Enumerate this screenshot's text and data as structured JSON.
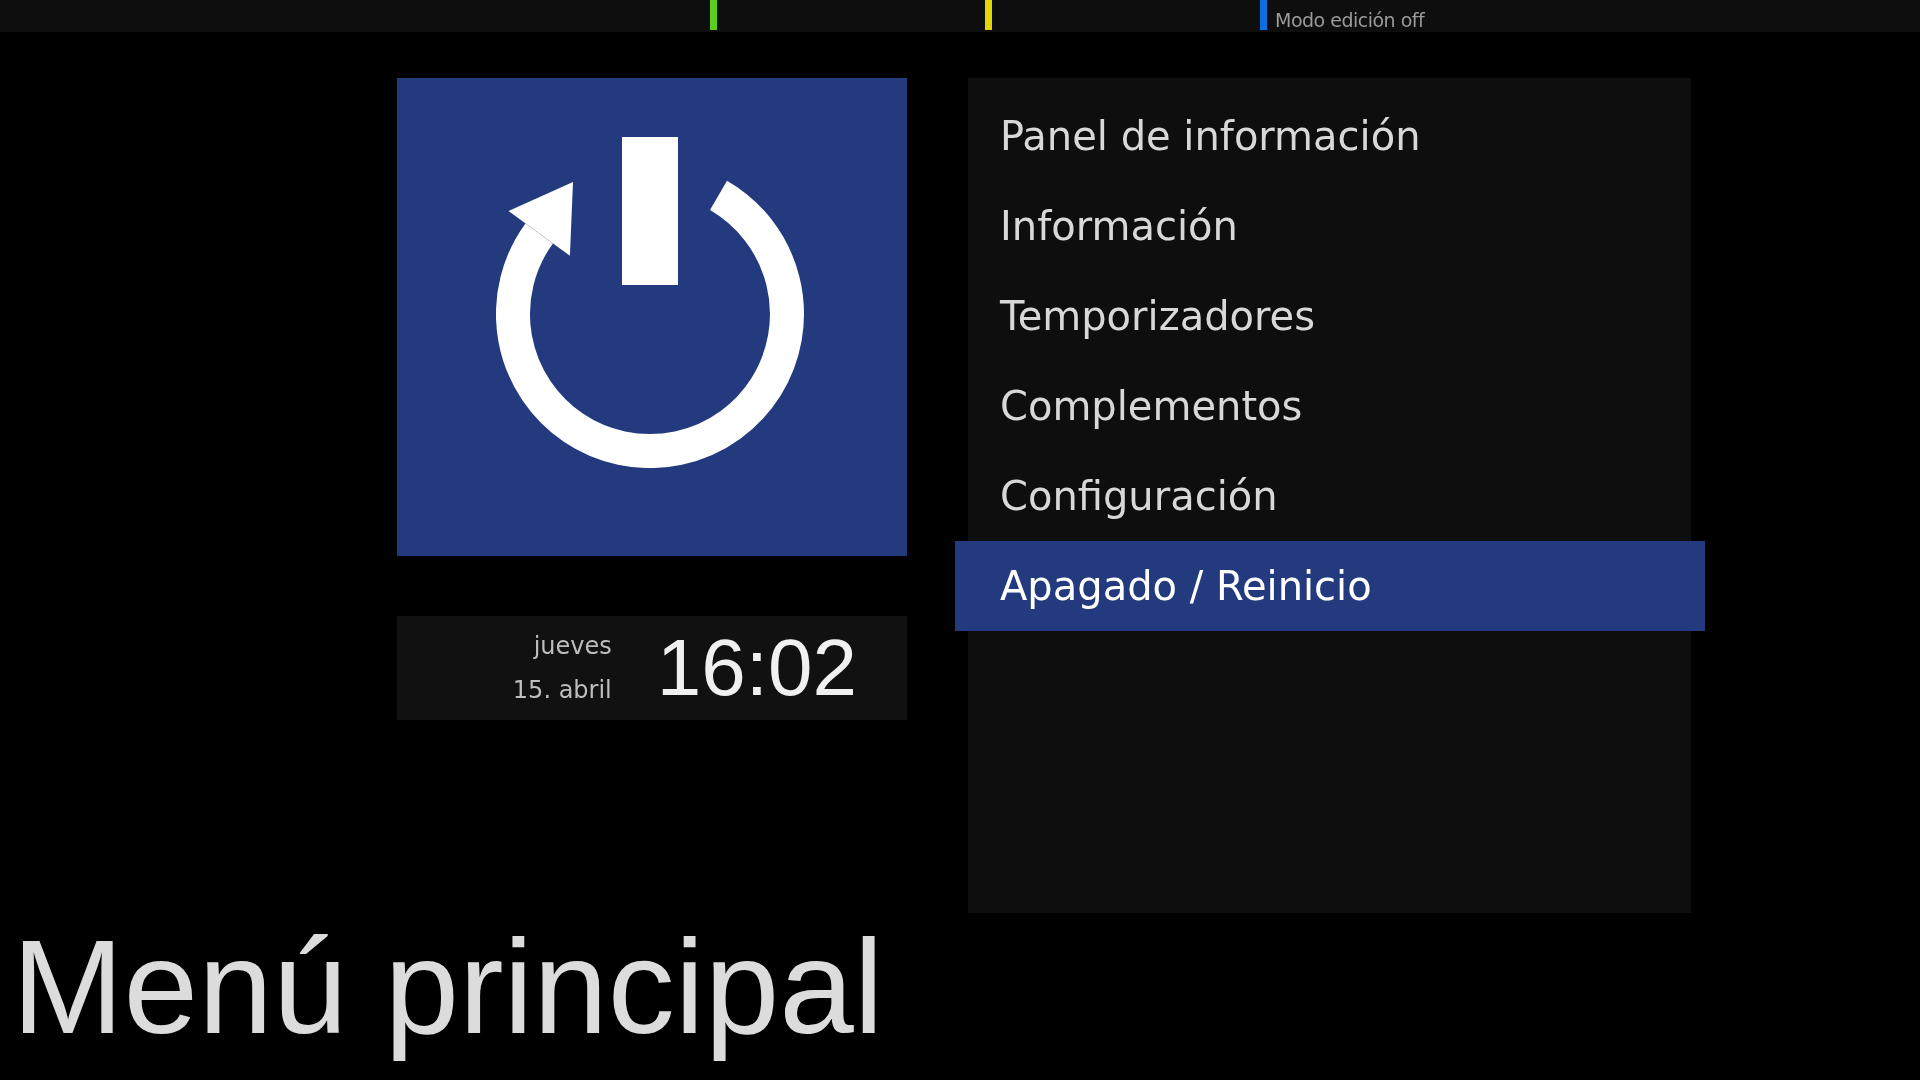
{
  "color_keys": [
    {
      "color": "#5ccd1c"
    },
    {
      "color": "#e6d40a"
    },
    {
      "color": "#0a6fe0",
      "label": "Modo edición off"
    }
  ],
  "clock": {
    "weekday": "jueves",
    "date": "15. abril",
    "time": "16:02"
  },
  "menu": {
    "items": [
      {
        "label": "Panel de información",
        "selected": false
      },
      {
        "label": "Información",
        "selected": false
      },
      {
        "label": "Temporizadores",
        "selected": false
      },
      {
        "label": "Complementos",
        "selected": false
      },
      {
        "label": "Configuración",
        "selected": false
      },
      {
        "label": "Apagado / Reinicio",
        "selected": true
      }
    ]
  },
  "title": "Menú principal"
}
